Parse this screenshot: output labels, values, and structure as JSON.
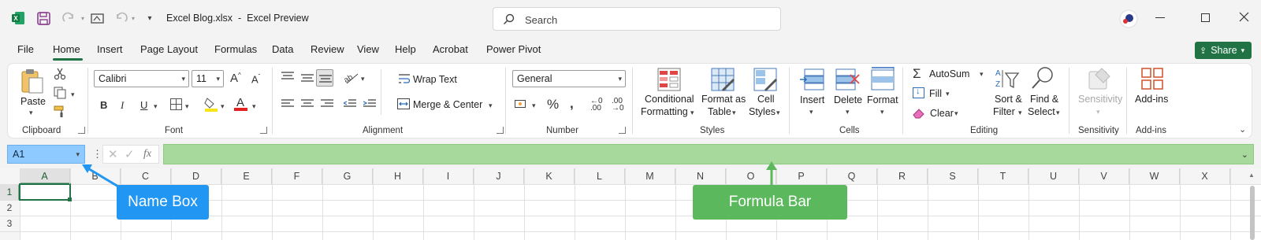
{
  "titlebar": {
    "title": "Excel Blog.xlsx  -  Excel Preview",
    "search_placeholder": "Search"
  },
  "menu": {
    "tabs": [
      "File",
      "Home",
      "Insert",
      "Page Layout",
      "Formulas",
      "Data",
      "Review",
      "View",
      "Help",
      "Acrobat",
      "Power Pivot"
    ],
    "active": "Home",
    "share_label": "Share"
  },
  "ribbon": {
    "clipboard": {
      "paste": "Paste",
      "group": "Clipboard"
    },
    "font": {
      "name": "Calibri",
      "size": "11",
      "group": "Font"
    },
    "alignment": {
      "wrap": "Wrap Text",
      "merge": "Merge & Center",
      "group": "Alignment"
    },
    "number": {
      "format": "General",
      "group": "Number"
    },
    "styles": {
      "conditional_1": "Conditional",
      "conditional_2": "Formatting",
      "format_table_1": "Format as",
      "format_table_2": "Table",
      "cell_styles_1": "Cell",
      "cell_styles_2": "Styles",
      "group": "Styles"
    },
    "cells": {
      "insert": "Insert",
      "delete": "Delete",
      "format": "Format",
      "group": "Cells"
    },
    "editing": {
      "autosum": "AutoSum",
      "fill": "Fill",
      "clear": "Clear",
      "sort_1": "Sort &",
      "sort_2": "Filter",
      "find_1": "Find &",
      "find_2": "Select",
      "group": "Editing"
    },
    "sensitivity": {
      "label": "Sensitivity",
      "group": "Sensitivity"
    },
    "addins": {
      "label": "Add-ins",
      "group": "Add-ins"
    }
  },
  "formula": {
    "namebox_value": "A1",
    "fx": "fx"
  },
  "grid": {
    "columns": [
      "A",
      "B",
      "C",
      "D",
      "E",
      "F",
      "G",
      "H",
      "I",
      "J",
      "K",
      "L",
      "M",
      "N",
      "O",
      "P",
      "Q",
      "R",
      "S",
      "T",
      "U",
      "V",
      "W",
      "X"
    ],
    "rows": [
      "1",
      "2",
      "3"
    ]
  },
  "callouts": {
    "namebox": "Name Box",
    "formulabar": "Formula Bar",
    "namebox_color": "#2196f3",
    "formulabar_color": "#5cb85c"
  }
}
